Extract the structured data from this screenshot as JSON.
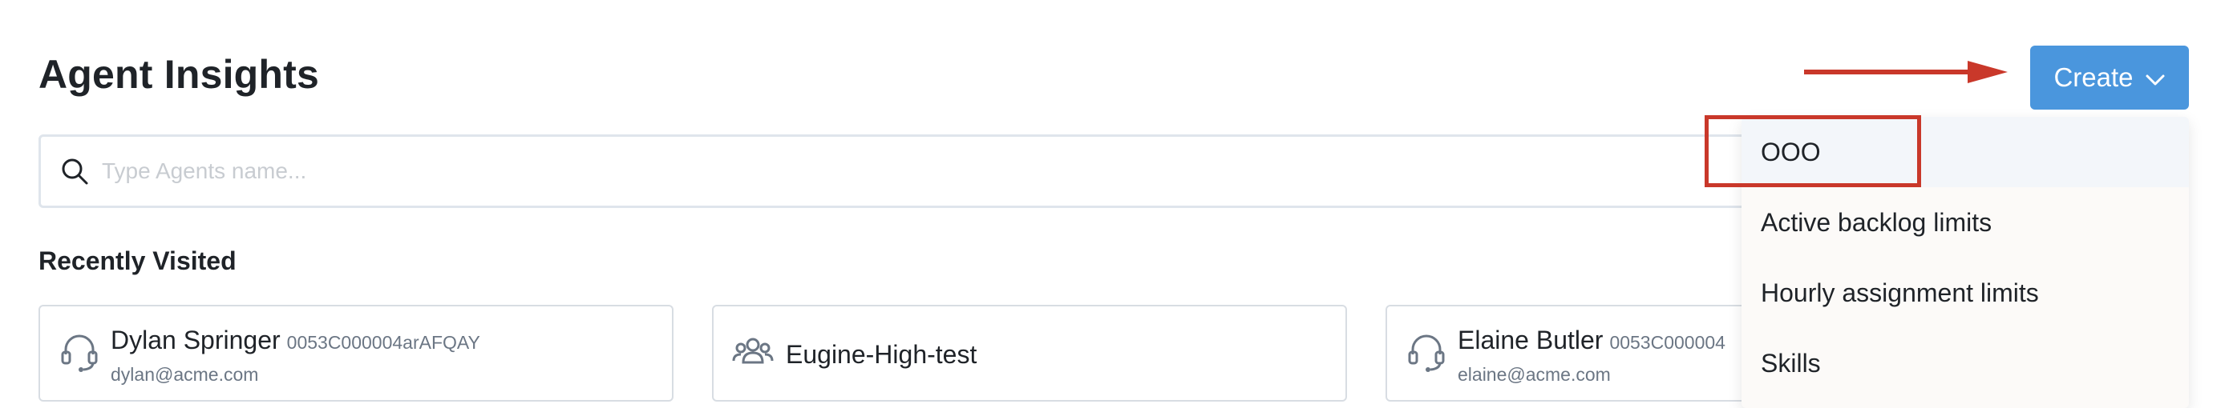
{
  "page": {
    "title": "Agent Insights"
  },
  "search": {
    "placeholder": "Type Agents name..."
  },
  "recent": {
    "title": "Recently Visited",
    "cards": [
      {
        "name": "Dylan Springer",
        "id": "0053C000004arAFQAY",
        "email": "dylan@acme.com",
        "icon": "headset-icon"
      },
      {
        "name": "Eugine-High-test",
        "icon": "group-icon"
      },
      {
        "name": "Elaine Butler",
        "id": "0053C000004",
        "email": "elaine@acme.com",
        "icon": "headset-icon"
      }
    ]
  },
  "create": {
    "label": "Create",
    "menu": [
      "OOO",
      "Active backlog limits",
      "Hourly assignment limits",
      "Skills"
    ]
  },
  "colors": {
    "accent": "#4a96dd",
    "annotation": "#c9382a",
    "text": "#1f2328",
    "muted": "#6b7684"
  }
}
